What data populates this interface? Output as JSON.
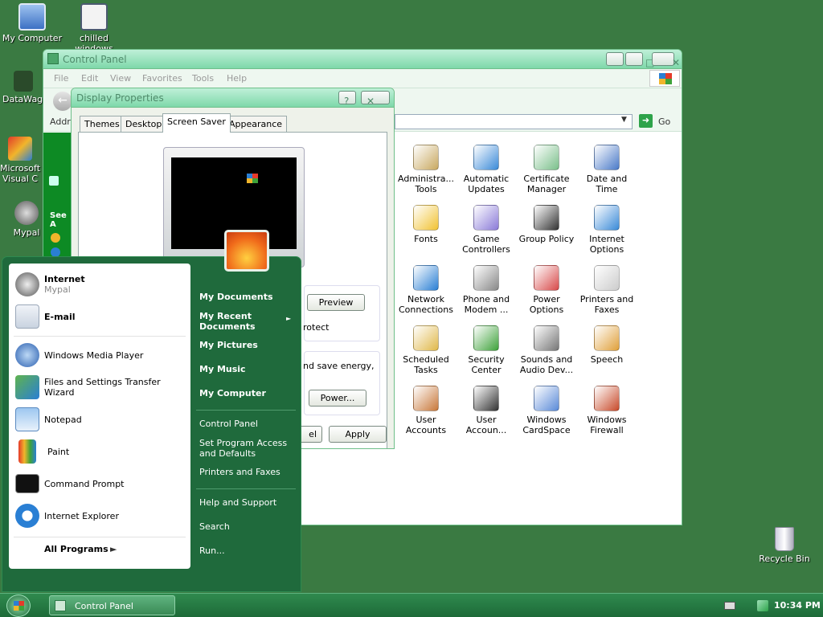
{
  "desktop": {
    "icons": [
      {
        "label": "My Computer",
        "icon": "computer-icon"
      },
      {
        "label": "chilled windows",
        "icon": "window-icon"
      },
      {
        "label": "DataWag",
        "icon": "datawag-icon"
      },
      {
        "label": "Microsoft Visual C",
        "icon": "visual-studio-icon"
      },
      {
        "label": "Mypal",
        "icon": "mypal-icon"
      },
      {
        "label": "Recycle Bin",
        "icon": "recycle-bin-icon"
      }
    ]
  },
  "control_panel": {
    "title": "Control Panel",
    "menu": [
      "File",
      "Edit",
      "View",
      "Favorites",
      "Tools",
      "Help"
    ],
    "address_label": "Addr",
    "go_label": "Go",
    "left_pane": {
      "see_also": "See A"
    },
    "items": [
      {
        "label": "Administra... Tools",
        "icon": "admin-tools-icon"
      },
      {
        "label": "Automatic Updates",
        "icon": "updates-icon"
      },
      {
        "label": "Certificate Manager",
        "icon": "certificate-icon"
      },
      {
        "label": "Date and Time",
        "icon": "clock-icon"
      },
      {
        "label": "Fonts",
        "icon": "fonts-folder-icon"
      },
      {
        "label": "Game Controllers",
        "icon": "gamepad-icon"
      },
      {
        "label": "Group Policy",
        "icon": "group-policy-icon"
      },
      {
        "label": "Internet Options",
        "icon": "internet-options-icon"
      },
      {
        "label": "Network Connections",
        "icon": "network-icon"
      },
      {
        "label": "Phone and Modem ...",
        "icon": "phone-icon"
      },
      {
        "label": "Power Options",
        "icon": "power-icon"
      },
      {
        "label": "Printers and Faxes",
        "icon": "printer-icon"
      },
      {
        "label": "Scheduled Tasks",
        "icon": "tasks-folder-icon"
      },
      {
        "label": "Security Center",
        "icon": "shield-icon"
      },
      {
        "label": "Sounds and Audio Dev...",
        "icon": "speaker-icon"
      },
      {
        "label": "Speech",
        "icon": "speech-icon"
      },
      {
        "label": "User Accounts",
        "icon": "users-icon"
      },
      {
        "label": "User Accoun...",
        "icon": "user-key-icon"
      },
      {
        "label": "Windows CardSpace",
        "icon": "cardspace-icon"
      },
      {
        "label": "Windows Firewall",
        "icon": "firewall-icon"
      }
    ]
  },
  "display_properties": {
    "title": "Display Properties",
    "tabs": [
      "Themes",
      "Desktop",
      "Screen Saver",
      "Appearance"
    ],
    "active_tab": "Screen Saver",
    "preview_button": "Preview",
    "protect_text": "rotect",
    "energy_text": "nd save energy,",
    "power_button": "Power...",
    "cancel_fragment": "el",
    "apply_button": "Apply"
  },
  "start_menu": {
    "pinned": [
      {
        "label": "Internet",
        "sub": "Mypal",
        "icon": "mypal-icon"
      },
      {
        "label": "E-mail",
        "sub": "",
        "icon": "email-icon"
      }
    ],
    "recent": [
      {
        "label": "Windows Media Player",
        "icon": "media-player-icon"
      },
      {
        "label": "Files and Settings Transfer Wizard",
        "icon": "transfer-wizard-icon"
      },
      {
        "label": "Notepad",
        "icon": "notepad-icon"
      },
      {
        "label": "Paint",
        "icon": "paint-icon"
      },
      {
        "label": "Command Prompt",
        "icon": "command-prompt-icon"
      },
      {
        "label": "Internet Explorer",
        "icon": "ie-icon"
      }
    ],
    "all_programs": "All Programs",
    "right": {
      "my_documents": "My Documents",
      "my_recent_documents": "My Recent Documents",
      "my_pictures": "My Pictures",
      "my_music": "My Music",
      "my_computer": "My Computer",
      "control_panel": "Control Panel",
      "set_program_access": "Set Program Access and Defaults",
      "printers_and_faxes": "Printers and Faxes",
      "help_and_support": "Help and Support",
      "search": "Search",
      "run": "Run..."
    }
  },
  "taskbar": {
    "task": "Control Panel",
    "clock": "10:34 PM"
  }
}
